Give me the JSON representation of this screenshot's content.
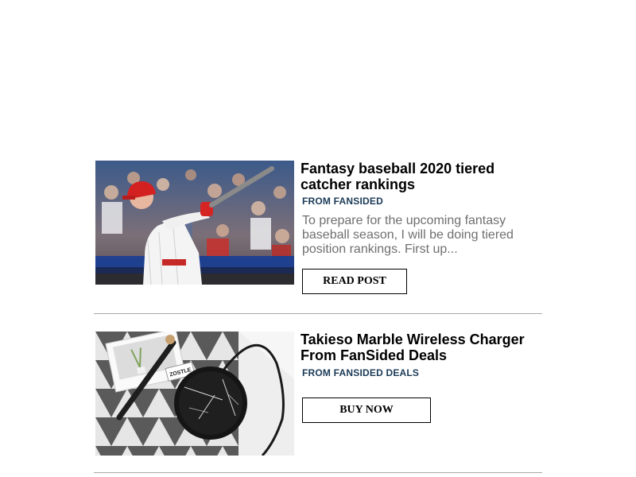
{
  "posts": [
    {
      "title": "Fantasy baseball 2020 tiered catcher rankings",
      "source": "FROM FANSIDED",
      "excerpt": "To prepare for the upcoming fantasy baseball season, I will be doing tiered position rankings. First up...",
      "button_label": "READ POST",
      "image": "baseball-batter-swinging-photo"
    },
    {
      "title": "Takieso Marble Wireless Charger From FanSided Deals",
      "source": "FROM FANSIDED DEALS",
      "button_label": "BUY NOW",
      "image": "marble-wireless-charger-photo",
      "image_text": "ZOSTLE"
    }
  ]
}
